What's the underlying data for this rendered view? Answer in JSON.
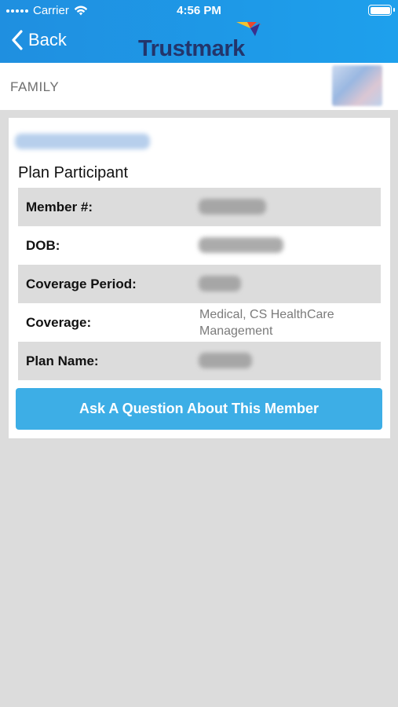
{
  "status_bar": {
    "carrier": "Carrier",
    "time": "4:56 PM"
  },
  "nav": {
    "back_label": "Back",
    "logo_text": "Trustmark"
  },
  "subheader": {
    "label": "FAMILY"
  },
  "card": {
    "section_title": "Plan Participant",
    "rows": [
      {
        "label": "Member #:",
        "value": ""
      },
      {
        "label": "DOB:",
        "value": ""
      },
      {
        "label": "Coverage Period:",
        "value": ""
      },
      {
        "label": "Coverage:",
        "value": "Medical, CS HealthCare Management"
      },
      {
        "label": "Plan Name:",
        "value": ""
      }
    ],
    "ask_button": "Ask A Question About This Member"
  },
  "colors": {
    "header": "#1f8fe0",
    "button": "#3daee6",
    "logo": "#23356b",
    "background": "#dcdcdc"
  }
}
